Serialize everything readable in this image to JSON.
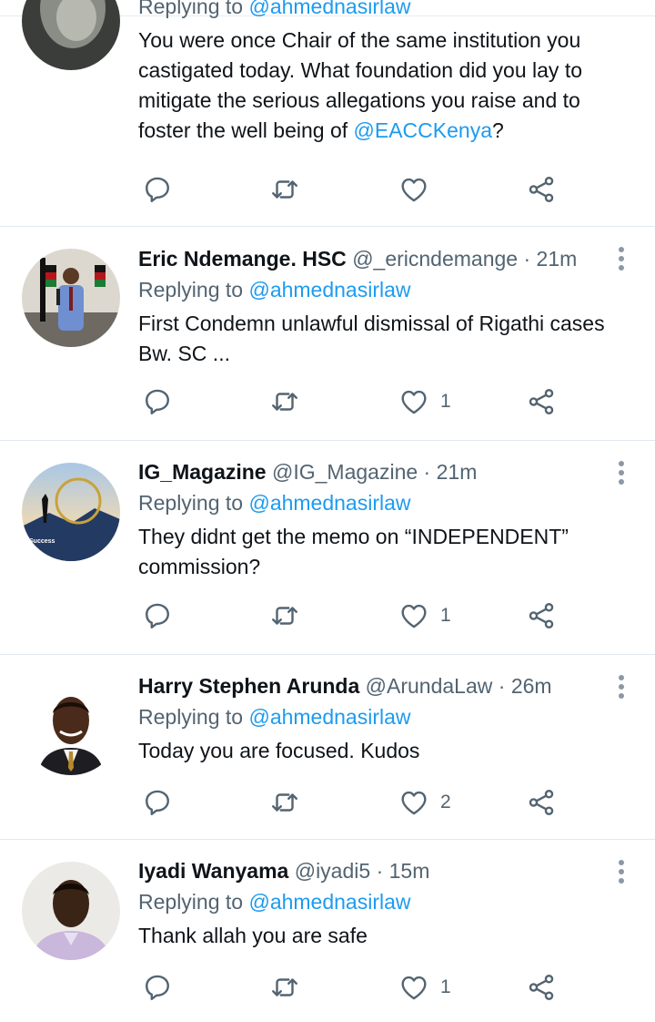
{
  "tweets": [
    {
      "name": "",
      "handle": "",
      "time": "",
      "replying_prefix": "Replying to",
      "replying_handle": "@ahmednasirlaw",
      "body_parts": [
        "You were once Chair of the same institution you castigated today. What foundation did you lay to mitigate the serious allegations you raise and to foster the well being of ",
        "@EACCKenya",
        "?"
      ],
      "likes": ""
    },
    {
      "name": "Eric Ndemange. HSC",
      "handle": "@_ericndemange",
      "sep": "·",
      "time": "21m",
      "replying_prefix": "Replying to",
      "replying_handle": "@ahmednasirlaw",
      "body": "First Condemn unlawful dismissal of Rigathi cases Bw. SC ...",
      "likes": "1"
    },
    {
      "name": "IG_Magazine",
      "handle": "@IG_Magazine",
      "sep": "·",
      "time": "21m",
      "replying_prefix": "Replying to",
      "replying_handle": "@ahmednasirlaw",
      "body": "They didnt get the memo on “INDEPENDENT” commission?",
      "likes": "1",
      "avatar_text": "Success"
    },
    {
      "name": "Harry Stephen Arunda",
      "handle": "@ArundaLaw",
      "sep": "·",
      "time": "26m",
      "replying_prefix": "Replying to",
      "replying_handle": "@ahmednasirlaw",
      "body": "Today you are focused. Kudos",
      "likes": "2"
    },
    {
      "name": "Iyadi Wanyama",
      "handle": "@iyadi5",
      "sep": "·",
      "time": "15m",
      "replying_prefix": "Replying to",
      "replying_handle": "@ahmednasirlaw",
      "body": "Thank allah you are safe",
      "likes": "1"
    }
  ],
  "icons": {
    "reply": "reply-icon",
    "retweet": "retweet-icon",
    "like": "heart-icon",
    "share": "share-icon",
    "more": "more-vertical-icon"
  },
  "colors": {
    "mention": "#1d9bf0",
    "secondary_text": "#536471",
    "icon": "#536471",
    "divider": "#e1e8ed"
  }
}
